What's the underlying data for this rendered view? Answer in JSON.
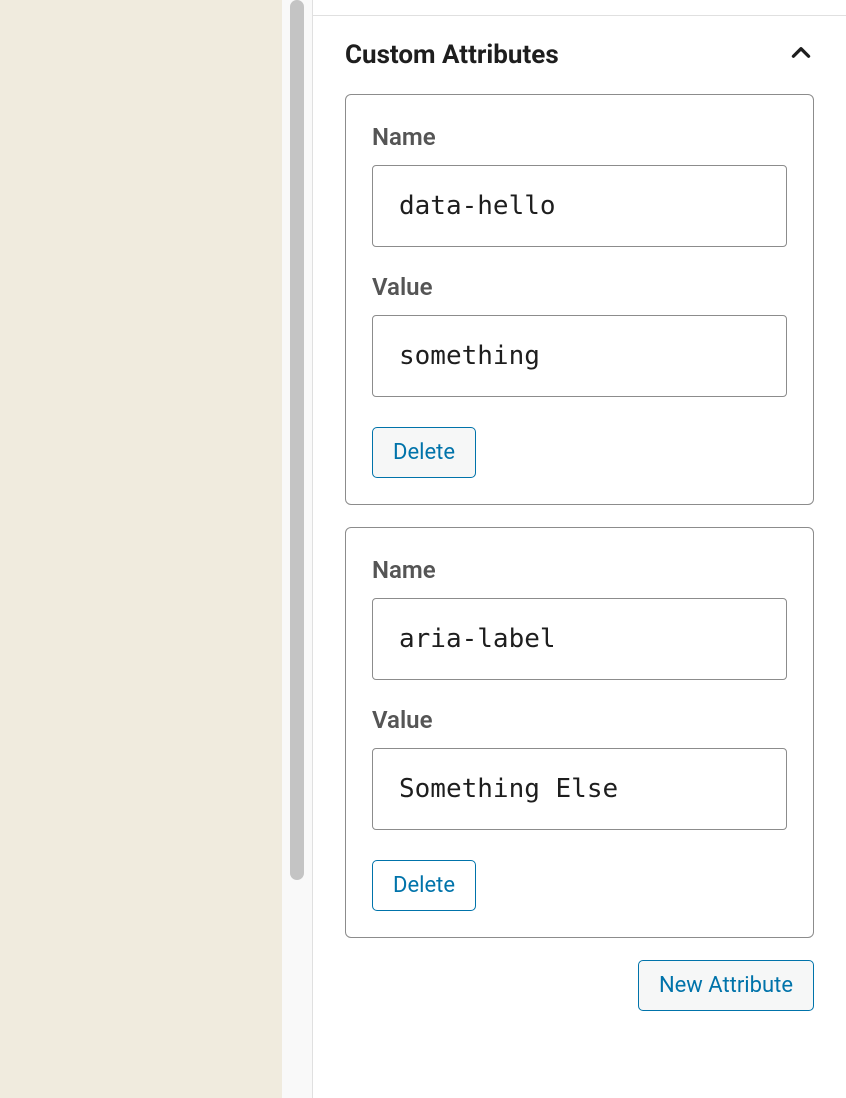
{
  "panel": {
    "title": "Custom Attributes",
    "expanded": true,
    "new_attribute_label": "New Attribute"
  },
  "labels": {
    "name": "Name",
    "value": "Value",
    "delete": "Delete"
  },
  "attributes": [
    {
      "name": "data-hello",
      "value": "something"
    },
    {
      "name": "aria-label",
      "value": "Something Else"
    }
  ]
}
